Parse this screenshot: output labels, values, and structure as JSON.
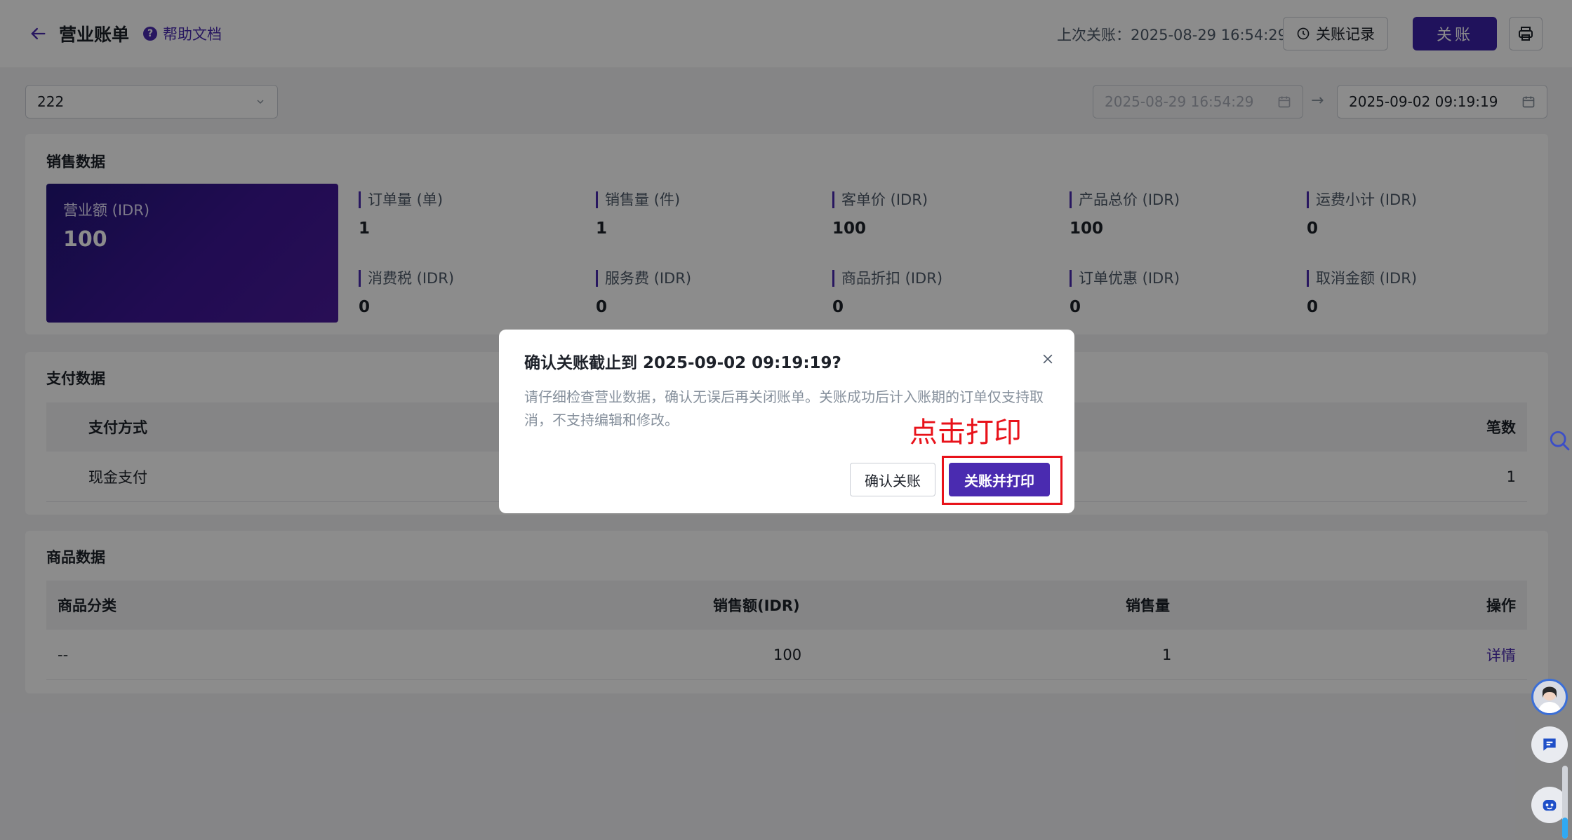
{
  "header": {
    "title": "营业账单",
    "help_label": "帮助文档",
    "last_close_label": "上次关账：2025-08-29 16:54:29",
    "history_label": "关账记录",
    "close_label": "关账"
  },
  "filters": {
    "store_value": "222",
    "date_start": "2025-08-29 16:54:29",
    "date_end": "2025-09-02 09:19:19"
  },
  "sales": {
    "title": "销售数据",
    "revenue_label": "营业额 (IDR)",
    "revenue_value": "100",
    "metrics": [
      {
        "label": "订单量 (单)",
        "value": "1"
      },
      {
        "label": "销售量 (件)",
        "value": "1"
      },
      {
        "label": "客单价 (IDR)",
        "value": "100"
      },
      {
        "label": "产品总价 (IDR)",
        "value": "100"
      },
      {
        "label": "运费小计 (IDR)",
        "value": "0"
      },
      {
        "label": "消费税 (IDR)",
        "value": "0"
      },
      {
        "label": "服务费 (IDR)",
        "value": "0"
      },
      {
        "label": "商品折扣 (IDR)",
        "value": "0"
      },
      {
        "label": "订单优惠 (IDR)",
        "value": "0"
      },
      {
        "label": "取消金额 (IDR)",
        "value": "0"
      }
    ]
  },
  "payment": {
    "title": "支付数据",
    "col_method": "支付方式",
    "col_count": "笔数",
    "rows": [
      {
        "method": "现金支付",
        "count": "1"
      }
    ]
  },
  "goods": {
    "title": "商品数据",
    "col_category": "商品分类",
    "col_sales": "销售额(IDR)",
    "col_qty": "销售量",
    "col_action": "操作",
    "rows": [
      {
        "category": "--",
        "sales": "100",
        "qty": "1",
        "action": "详情"
      }
    ]
  },
  "modal": {
    "title": "确认关账截止到 2025-09-02 09:19:19?",
    "body": "请仔细检查营业数据，确认无误后再关闭账单。关账成功后计入账期的订单仅支持取消，不支持编辑和修改。",
    "annotation": "点击打印",
    "confirm_label": "确认关账",
    "print_label": "关账并打印"
  },
  "colors": {
    "brand": "#4a2bb0",
    "annotation": "#e8121a"
  }
}
